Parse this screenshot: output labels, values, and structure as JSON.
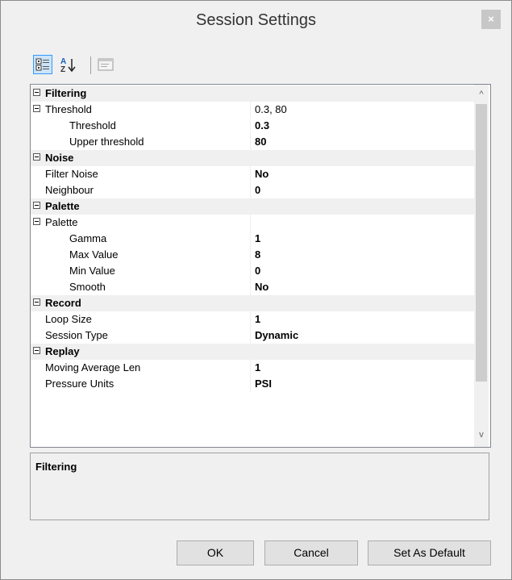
{
  "window": {
    "title": "Session Settings",
    "close_glyph": "×"
  },
  "toolbar": {
    "categorized_icon": "categorized-view-icon",
    "alphabetical_icon": "sort-alphabetical-icon",
    "pages_icon": "property-pages-icon"
  },
  "grid": {
    "rows": [
      {
        "kind": "category",
        "label": "Filtering"
      },
      {
        "kind": "group",
        "label": "Threshold",
        "value": "0.3, 80"
      },
      {
        "kind": "child",
        "label": "Threshold",
        "value": "0.3"
      },
      {
        "kind": "child",
        "label": "Upper threshold",
        "value": "80"
      },
      {
        "kind": "category",
        "label": "Noise"
      },
      {
        "kind": "prop",
        "label": "Filter Noise",
        "value": "No"
      },
      {
        "kind": "prop",
        "label": "Neighbour",
        "value": "0"
      },
      {
        "kind": "category",
        "label": "Palette"
      },
      {
        "kind": "group",
        "label": "Palette",
        "value": ""
      },
      {
        "kind": "child",
        "label": "Gamma",
        "value": "1"
      },
      {
        "kind": "child",
        "label": "Max Value",
        "value": "8"
      },
      {
        "kind": "child",
        "label": "Min Value",
        "value": "0"
      },
      {
        "kind": "child",
        "label": "Smooth",
        "value": "No"
      },
      {
        "kind": "category",
        "label": "Record"
      },
      {
        "kind": "prop",
        "label": "Loop Size",
        "value": "1"
      },
      {
        "kind": "prop",
        "label": "Session Type",
        "value": "Dynamic"
      },
      {
        "kind": "category",
        "label": "Replay"
      },
      {
        "kind": "prop",
        "label": "Moving Average Len",
        "value": "1"
      },
      {
        "kind": "prop",
        "label": "Pressure Units",
        "value": "PSI"
      }
    ],
    "scroll_up_glyph": "^",
    "scroll_down_glyph": "v"
  },
  "description": {
    "title": "Filtering"
  },
  "buttons": {
    "ok": "OK",
    "cancel": "Cancel",
    "default": "Set As Default"
  }
}
